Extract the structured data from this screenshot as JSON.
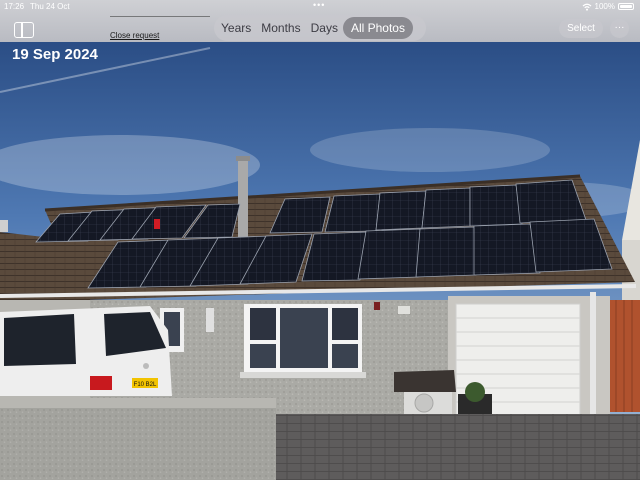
{
  "status_bar": {
    "time": "17:26",
    "date": "Thu 24 Oct",
    "battery": "100%",
    "more_indicator": "•••"
  },
  "toolbar": {
    "close_request_label": "Close request",
    "tabs": [
      {
        "label": "Years",
        "active": false
      },
      {
        "label": "Months",
        "active": false
      },
      {
        "label": "Days",
        "active": false
      },
      {
        "label": "All Photos",
        "active": true
      }
    ],
    "select_label": "Select",
    "more_label": "···"
  },
  "photo": {
    "date_label": "19 Sep 2024",
    "van_plate": "F10 B2L"
  }
}
